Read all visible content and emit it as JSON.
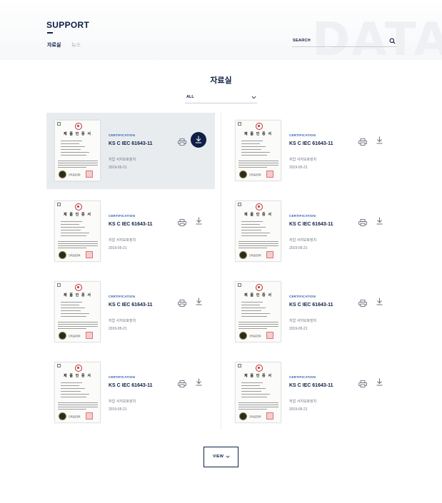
{
  "header": {
    "title": "SUPPORT",
    "watermark": "DATA",
    "tabs": [
      {
        "label": "자료실",
        "active": true
      },
      {
        "label": "뉴스",
        "active": false
      }
    ],
    "search": {
      "label": "SEARCH",
      "icon": "search-icon"
    }
  },
  "main": {
    "title": "자료실",
    "filter": {
      "selected": "ALL",
      "icon": "chevron-down-icon"
    },
    "items": [
      {
        "thumb_title": "제 품 인 증 서",
        "thumb_org": "한국표준협회",
        "category": "CERTIFICATION",
        "name": "KS C IEC 61643-11",
        "desc": "저압 서지보호장치",
        "date": "2019-05-21",
        "highlighted": true
      },
      {
        "thumb_title": "제 품 인 증 서",
        "thumb_org": "한국표준협회",
        "category": "CERTIFICATION",
        "name": "KS C IEC 61643-11",
        "desc": "저압 서지보호장치",
        "date": "2019-05-21",
        "highlighted": false
      },
      {
        "thumb_title": "제 품 인 증 서",
        "thumb_org": "한국표준협회",
        "category": "CERTIFICATION",
        "name": "KS C IEC 61643-11",
        "desc": "저압 서지보호장치",
        "date": "2019-05-21",
        "highlighted": false
      },
      {
        "thumb_title": "제 품 인 증 서",
        "thumb_org": "한국표준협회",
        "category": "CERTIFICATION",
        "name": "KS C IEC 61643-11",
        "desc": "저압 서지보호장치",
        "date": "2019-05-21",
        "highlighted": false
      },
      {
        "thumb_title": "제 품 인 증 서",
        "thumb_org": "한국표준협회",
        "category": "CERTIFICATION",
        "name": "KS C IEC 61643-11",
        "desc": "저압 서지보호장치",
        "date": "2019-05-21",
        "highlighted": false
      },
      {
        "thumb_title": "제 품 인 증 서",
        "thumb_org": "한국표준협회",
        "category": "CERTIFICATION",
        "name": "KS C IEC 61643-11",
        "desc": "저압 서지보호장치",
        "date": "2019-05-21",
        "highlighted": false
      },
      {
        "thumb_title": "제 품 인 증 서",
        "thumb_org": "한국표준협회",
        "category": "CERTIFICATION",
        "name": "KS C IEC 61643-11",
        "desc": "저압 서지보호장치",
        "date": "2019-05-21",
        "highlighted": false
      },
      {
        "thumb_title": "제 품 인 증 서",
        "thumb_org": "한국표준협회",
        "category": "CERTIFICATION",
        "name": "KS C IEC 61643-11",
        "desc": "저압 서지보호장치",
        "date": "2019-05-21",
        "highlighted": false
      }
    ],
    "view_button": {
      "label": "VIEW",
      "icon": "chevron-down-icon"
    }
  },
  "colors": {
    "navy": "#0f1f45",
    "accent_blue": "#2f5fb0",
    "highlight_bg": "#e9ecef"
  }
}
